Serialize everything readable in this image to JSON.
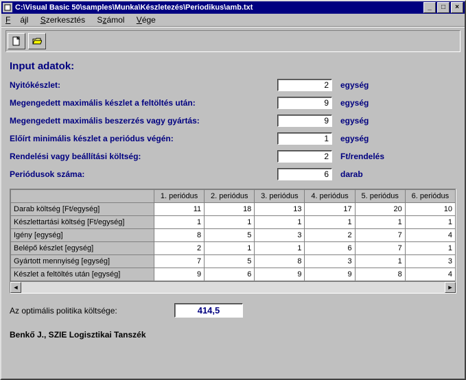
{
  "window": {
    "title": "C:\\Visual Basic 50\\samples\\Munka\\Készletezés\\Periodikus\\amb.txt"
  },
  "menu": {
    "file": "Fájl",
    "edit": "Szerkesztés",
    "calc": "Számol",
    "end": "Vége"
  },
  "heading": "Input adatok:",
  "form": {
    "rows": [
      {
        "label": "Nyitókészlet:",
        "value": "2",
        "unit": "egység"
      },
      {
        "label": "Megengedett maximális készlet a feltöltés után:",
        "value": "9",
        "unit": "egység"
      },
      {
        "label": "Megengedett maximális beszerzés vagy gyártás:",
        "value": "9",
        "unit": "egység"
      },
      {
        "label": "Előírt minimális készlet a periódus végén:",
        "value": "1",
        "unit": "egység"
      },
      {
        "label": "Rendelési vagy beállítási költség:",
        "value": "2",
        "unit": "Ft/rendelés"
      },
      {
        "label": "Periódusok száma:",
        "value": "6",
        "unit": "darab"
      }
    ]
  },
  "table": {
    "periods": [
      "1. periódus",
      "2. periódus",
      "3. periódus",
      "4. periódus",
      "5. periódus",
      "6. periódus"
    ],
    "rows": [
      {
        "name": "Darab költség [Ft/egység]",
        "v": [
          "11",
          "18",
          "13",
          "17",
          "20",
          "10"
        ]
      },
      {
        "name": "Készlettartási költség [Ft/egység]",
        "v": [
          "1",
          "1",
          "1",
          "1",
          "1",
          "1"
        ]
      },
      {
        "name": "Igény [egység]",
        "v": [
          "8",
          "5",
          "3",
          "2",
          "7",
          "4"
        ]
      },
      {
        "name": "Belépő készlet [egység]",
        "v": [
          "2",
          "1",
          "1",
          "6",
          "7",
          "1"
        ]
      },
      {
        "name": "Gyártott mennyiség [egység]",
        "v": [
          "7",
          "5",
          "8",
          "3",
          "1",
          "3"
        ]
      },
      {
        "name": "Készlet a feltöltés után [egység]",
        "v": [
          "9",
          "6",
          "9",
          "9",
          "8",
          "4"
        ]
      }
    ]
  },
  "result": {
    "label": "Az optimális politika költsége:",
    "value": "414,5"
  },
  "footer": "Benkő J., SZIE Logisztikai Tanszék"
}
